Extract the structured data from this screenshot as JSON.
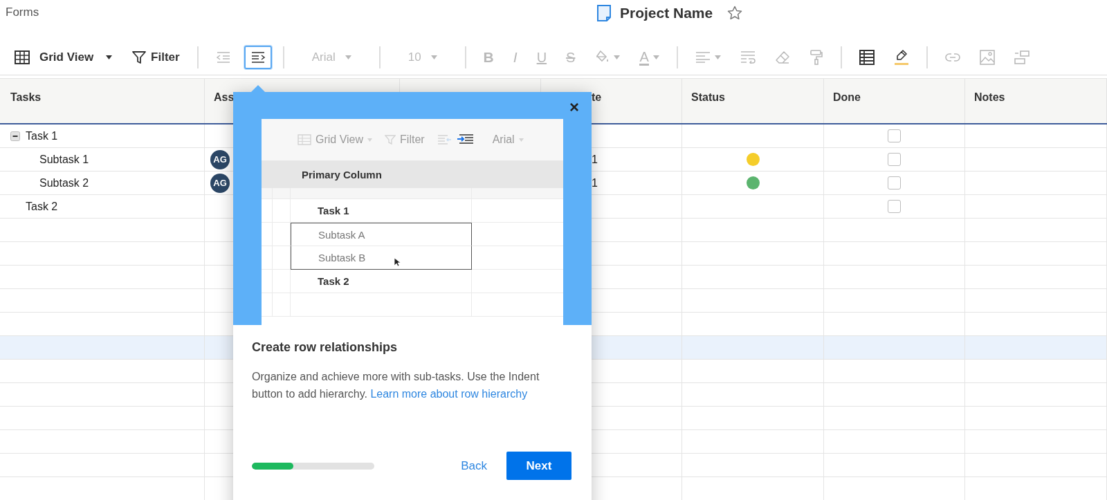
{
  "app": {
    "section": "Forms",
    "title": "Project Name",
    "favorite": false
  },
  "toolbar": {
    "items": [
      {
        "kind": "view",
        "label": "Grid View",
        "disabled": false,
        "highlighted": false
      },
      {
        "kind": "filter",
        "label": "Filter",
        "disabled": false,
        "highlighted": false
      },
      {
        "kind": "divider"
      },
      {
        "kind": "outdent",
        "disabled": true,
        "highlighted": false
      },
      {
        "kind": "indent",
        "disabled": false,
        "highlighted": true
      },
      {
        "kind": "divider"
      },
      {
        "kind": "font",
        "label": "Arial",
        "disabled": true,
        "highlighted": false
      },
      {
        "kind": "divider"
      },
      {
        "kind": "size",
        "label": "10",
        "disabled": true,
        "highlighted": false
      },
      {
        "kind": "divider"
      },
      {
        "kind": "bold",
        "label": "B",
        "disabled": true,
        "highlighted": false
      },
      {
        "kind": "italic",
        "label": "I",
        "disabled": true,
        "highlighted": false
      },
      {
        "kind": "underline",
        "label": "U",
        "disabled": true,
        "highlighted": false
      },
      {
        "kind": "strike",
        "label": "S",
        "disabled": true,
        "highlighted": false
      },
      {
        "kind": "fill",
        "disabled": true,
        "highlighted": false
      },
      {
        "kind": "text-color",
        "label": "A",
        "disabled": true,
        "highlighted": false
      },
      {
        "kind": "divider"
      },
      {
        "kind": "align",
        "disabled": true,
        "highlighted": false
      },
      {
        "kind": "wrap",
        "disabled": true,
        "highlighted": false
      },
      {
        "kind": "clear",
        "disabled": true,
        "highlighted": false
      },
      {
        "kind": "paint-format",
        "disabled": true,
        "highlighted": false
      },
      {
        "kind": "divider"
      },
      {
        "kind": "grid",
        "disabled": false,
        "highlighted": false
      },
      {
        "kind": "highlight",
        "disabled": false,
        "highlighted": false
      },
      {
        "kind": "divider"
      },
      {
        "kind": "link",
        "disabled": true,
        "highlighted": false
      },
      {
        "kind": "image",
        "disabled": true,
        "highlighted": false
      },
      {
        "kind": "card",
        "disabled": true,
        "highlighted": false
      }
    ]
  },
  "table": {
    "header": {
      "tasks": "Tasks",
      "column_2": "Ass",
      "column_4": "te",
      "status": "Status",
      "done": "Done",
      "notes": "Notes"
    },
    "rows": [
      {
        "task": "Task 1",
        "expanded": true,
        "done": false,
        "selected": false,
        "children": [
          {
            "task": "Subtask 1",
            "assignee": "AG",
            "column_4": "1",
            "color": "#f5cd2a",
            "done": false,
            "selected": false
          },
          {
            "task": "Subtask 2",
            "assignee": "AG",
            "column_4": "1",
            "color": "#5bb46e",
            "done": false,
            "selected": false
          }
        ]
      },
      {
        "task": "Task 2",
        "done": false,
        "selected": false
      }
    ],
    "blank_rows": [
      {
        "selected": false
      },
      {
        "selected": false
      },
      {
        "selected": false
      },
      {
        "selected": false
      },
      {
        "selected": false
      },
      {
        "selected": true
      },
      {
        "selected": false
      },
      {
        "selected": false
      },
      {
        "selected": false
      },
      {
        "selected": false
      },
      {
        "selected": false
      },
      {
        "selected": false
      }
    ]
  },
  "tour": {
    "preview": {
      "toolbar": {
        "view": "Grid View",
        "filter": "Filter",
        "font": "Arial"
      },
      "column": "Primary Column",
      "rows": [
        {
          "label": "Task 1",
          "kind": "parent",
          "selected": false
        },
        {
          "label": "Subtask A",
          "kind": "child",
          "selected": true
        },
        {
          "label": "Subtask B",
          "kind": "child",
          "selected": true
        },
        {
          "label": "Task 2",
          "kind": "parent",
          "selected": false
        }
      ]
    },
    "close": "×",
    "title": "Create row relationships",
    "body": "Organize and achieve more with sub-tasks. Use the Indent button to add hierarchy.",
    "link": "Learn more about row hierarchy",
    "progress": {
      "level": 0.34
    },
    "back": "Back",
    "next": "Next"
  }
}
